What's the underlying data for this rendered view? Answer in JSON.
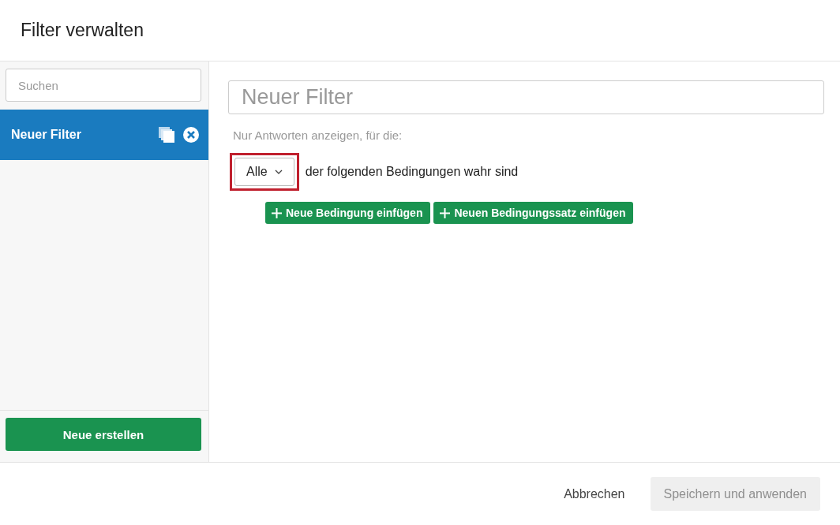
{
  "dialog": {
    "title": "Filter verwalten"
  },
  "sidebar": {
    "search": {
      "placeholder": "Suchen"
    },
    "items": [
      {
        "label": "Neuer Filter",
        "selected": true
      }
    ],
    "create_button": "Neue erstellen"
  },
  "editor": {
    "name_field": {
      "placeholder": "Neuer Filter"
    },
    "intro": "Nur Antworten anzeigen, für die:",
    "match_select": {
      "value": "Alle",
      "highlighted": true
    },
    "match_text": "der folgenden Bedingungen wahr sind",
    "actions": [
      {
        "label": "Neue Bedingung einfügen"
      },
      {
        "label": "Neuen Bedingungssatz einfügen"
      }
    ]
  },
  "footer": {
    "cancel": "Abbrechen",
    "apply": {
      "label": "Speichern und anwenden",
      "disabled": true
    }
  }
}
